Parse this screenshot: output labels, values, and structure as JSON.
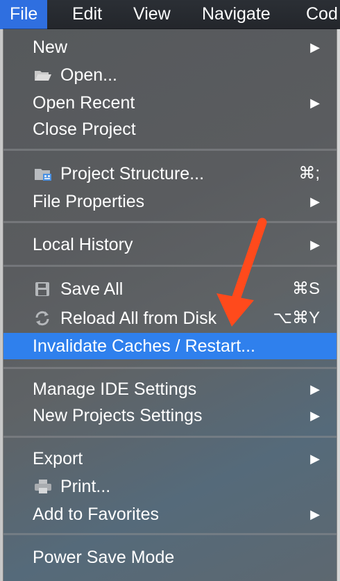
{
  "menubar": {
    "items": [
      "File",
      "Edit",
      "View",
      "Navigate",
      "Cod"
    ]
  },
  "menu": {
    "new": "New",
    "open": "Open...",
    "open_recent": "Open Recent",
    "close_project": "Close Project",
    "project_structure": "Project Structure...",
    "project_structure_shortcut": "⌘;",
    "file_properties": "File Properties",
    "local_history": "Local History",
    "save_all": "Save All",
    "save_all_shortcut": "⌘S",
    "reload_all": "Reload All from Disk",
    "reload_all_shortcut": "⌥⌘Y",
    "invalidate_caches": "Invalidate Caches / Restart...",
    "manage_ide_settings": "Manage IDE Settings",
    "new_projects_settings": "New Projects Settings",
    "export": "Export",
    "print": "Print...",
    "add_to_favorites": "Add to Favorites",
    "power_save_mode": "Power Save Mode",
    "submenu_glyph": "▶"
  },
  "colors": {
    "highlight": "#2f80ed",
    "menubar_active": "#2f6fe0",
    "annotation_arrow": "#ff4a1c"
  }
}
